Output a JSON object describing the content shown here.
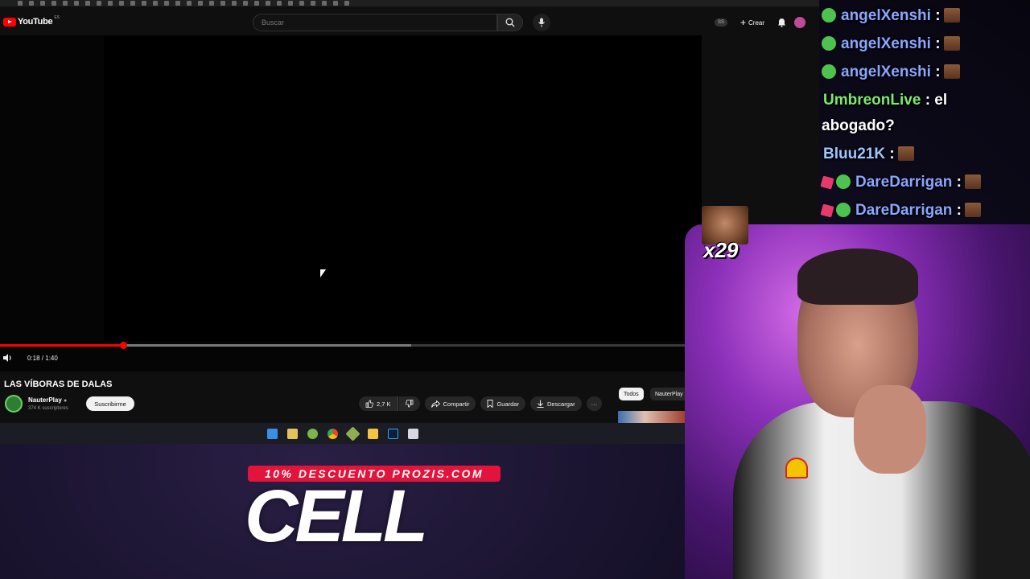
{
  "youtube": {
    "logo_text": "YouTube",
    "region": "ES",
    "search_placeholder": "Buscar",
    "ss_chip": "SS",
    "create_label": "Crear"
  },
  "player": {
    "time": "0:18 / 1:40",
    "played_fraction": 0.18,
    "buffered_fraction": 0.6
  },
  "video": {
    "title": "LAS VÍBORAS DE DALAS",
    "channel_name": "NauterPlay",
    "subscribers": "374 K suscriptores",
    "subscribe_label": "Suscribirme",
    "likes": "2,7 K",
    "share_label": "Compartir",
    "save_label": "Guardar",
    "download_label": "Descargar",
    "more_label": "···"
  },
  "related": {
    "chips": [
      "Todos",
      "NauterPlay"
    ]
  },
  "chat": {
    "messages": [
      {
        "user": "angelXenshi",
        "text": ":"
      },
      {
        "user": "angelXenshi",
        "text": ":"
      },
      {
        "user": "angelXenshi",
        "text": ":"
      },
      {
        "user": "UmbreonLive",
        "text": ": el"
      },
      {
        "user": "",
        "text": "abogado?"
      },
      {
        "user": "Bluu21K",
        "text": ":"
      },
      {
        "user": "DareDarrigan",
        "text": ":"
      },
      {
        "user": "DareDarrigan",
        "text": ":"
      }
    ],
    "combo_count": "x29"
  },
  "promo": {
    "banner": "10% DESCUENTO PROZIS.COM",
    "code": "CELL"
  },
  "colors": {
    "youtube_red": "#ff0000",
    "promo_red": "#e3143b",
    "chat_username": "#8aa6ff",
    "chat_green": "#7bea6a"
  }
}
